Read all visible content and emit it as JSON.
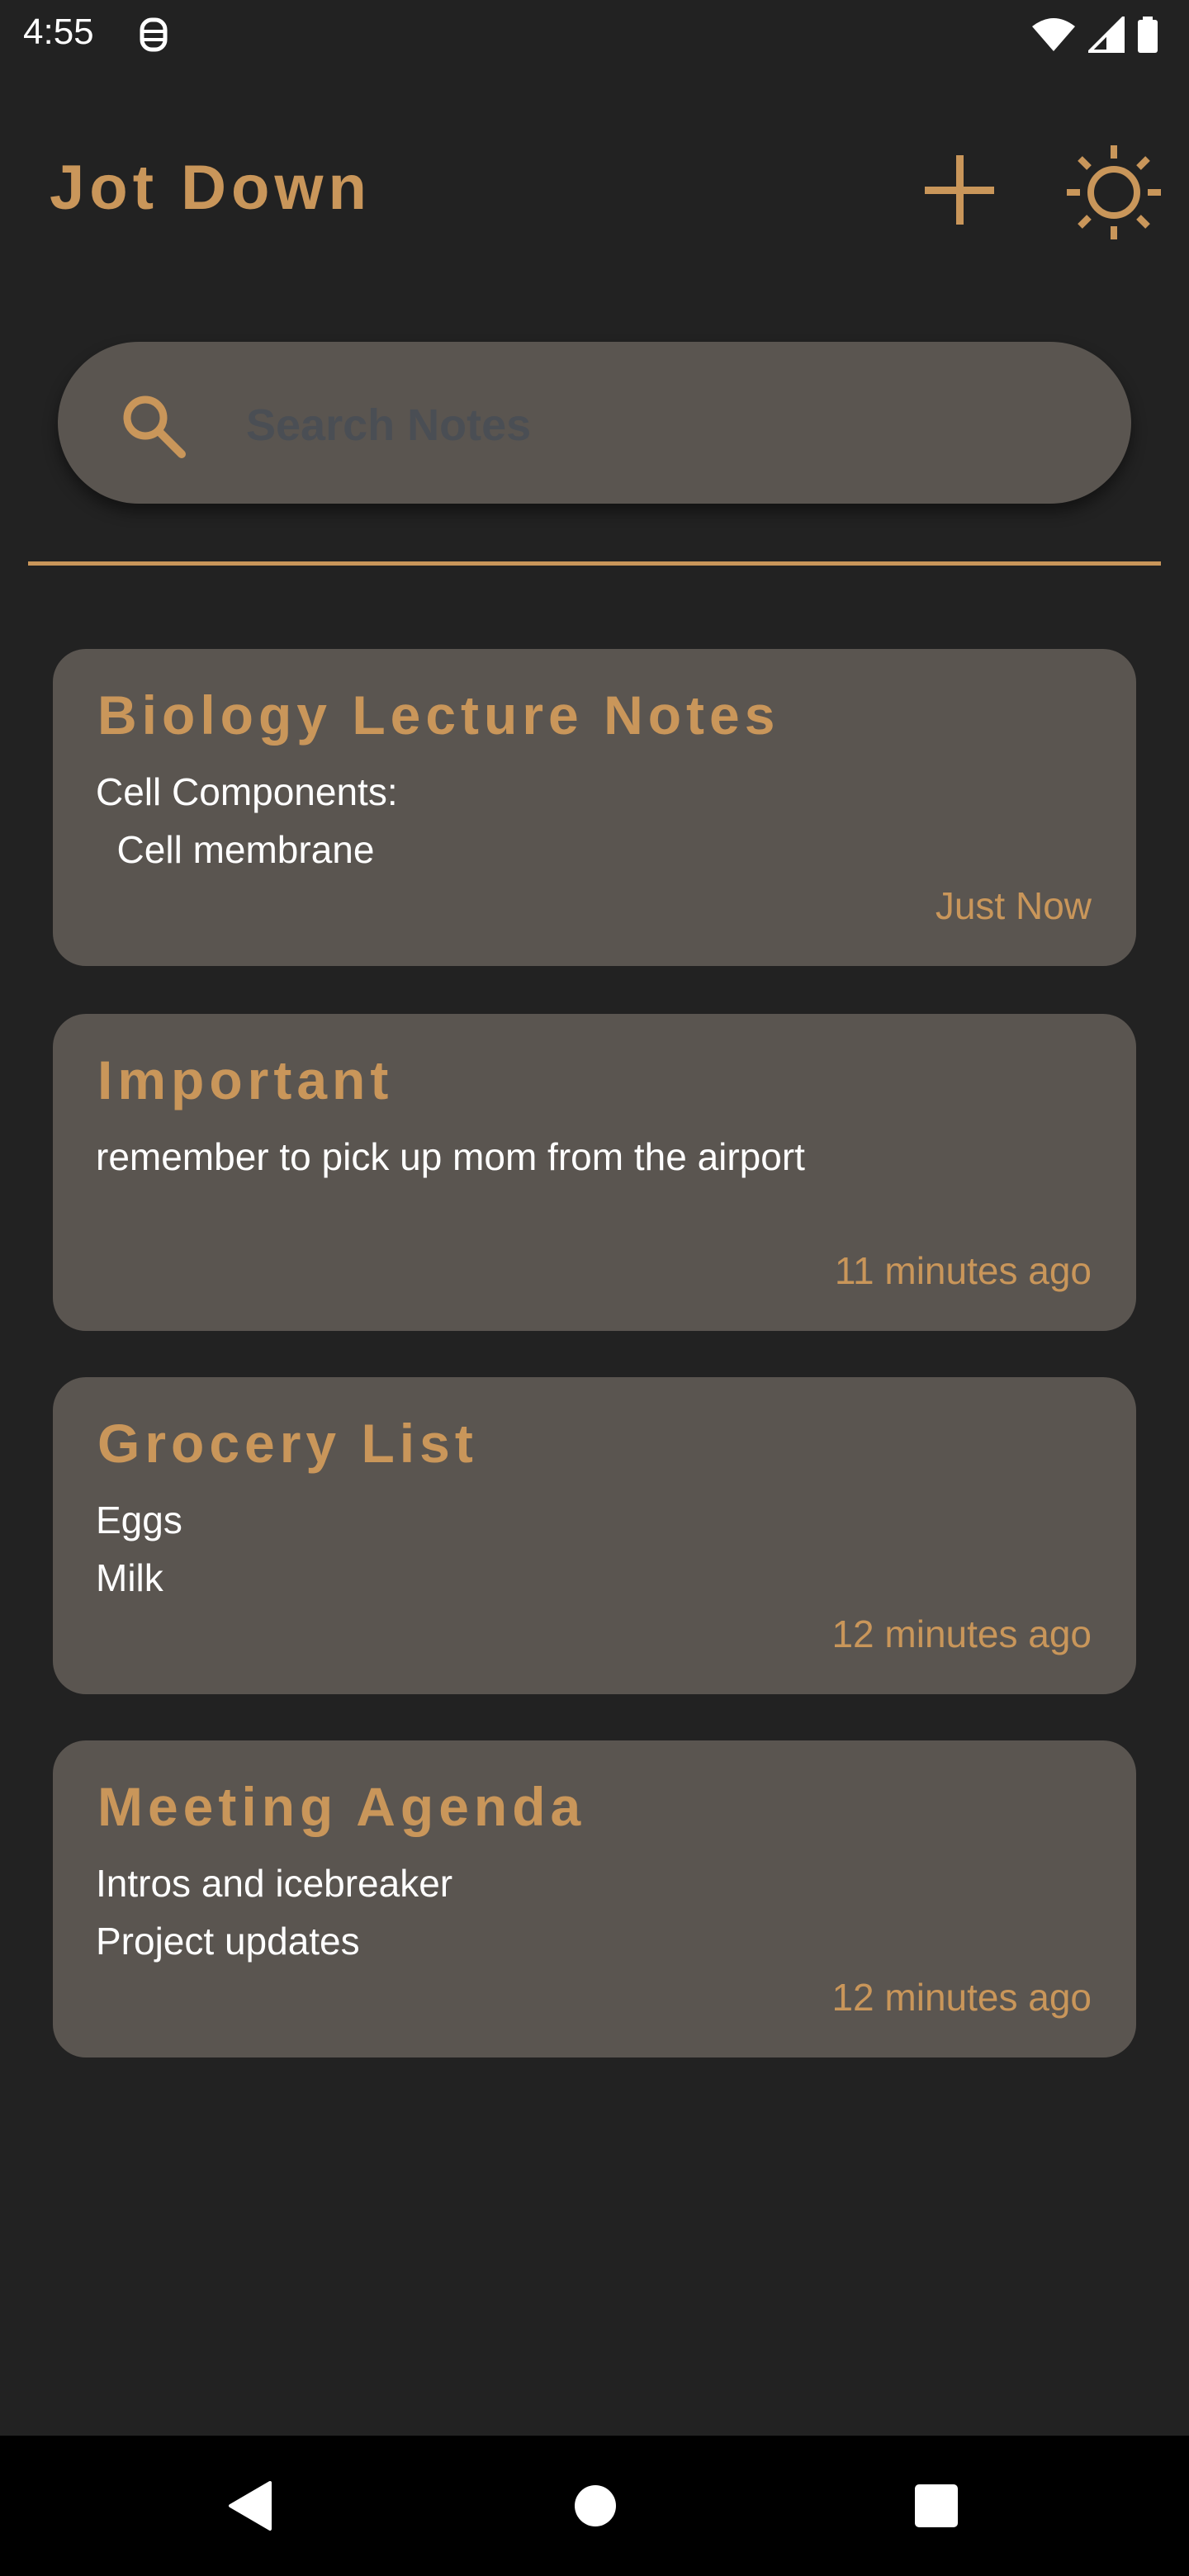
{
  "status_bar": {
    "time": "4:55",
    "icons": [
      "app-notification-icon",
      "wifi-icon",
      "cell-signal-icon",
      "battery-icon"
    ]
  },
  "header": {
    "title": "Jot Down",
    "add_icon": "plus-icon",
    "theme_icon": "sun-icon"
  },
  "search": {
    "placeholder": "Search Notes",
    "value": "",
    "icon": "search-icon"
  },
  "notes": [
    {
      "title": "Biology Lecture Notes",
      "body": "Cell Components:\n  Cell membrane",
      "time": "Just Now"
    },
    {
      "title": "Important",
      "body": "remember to pick up mom from the airport",
      "time": "11 minutes ago"
    },
    {
      "title": "Grocery List",
      "body": "Eggs\nMilk",
      "time": "12 minutes ago"
    },
    {
      "title": "Meeting Agenda",
      "body": "Intros and icebreaker\nProject updates",
      "time": "12 minutes ago"
    }
  ],
  "nav_bar": {
    "icons": [
      "back-icon",
      "home-icon",
      "recents-icon"
    ]
  },
  "colors": {
    "background": "#222222",
    "accent": "#c9965a",
    "card": "#5a5550",
    "text": "#ffffff"
  }
}
